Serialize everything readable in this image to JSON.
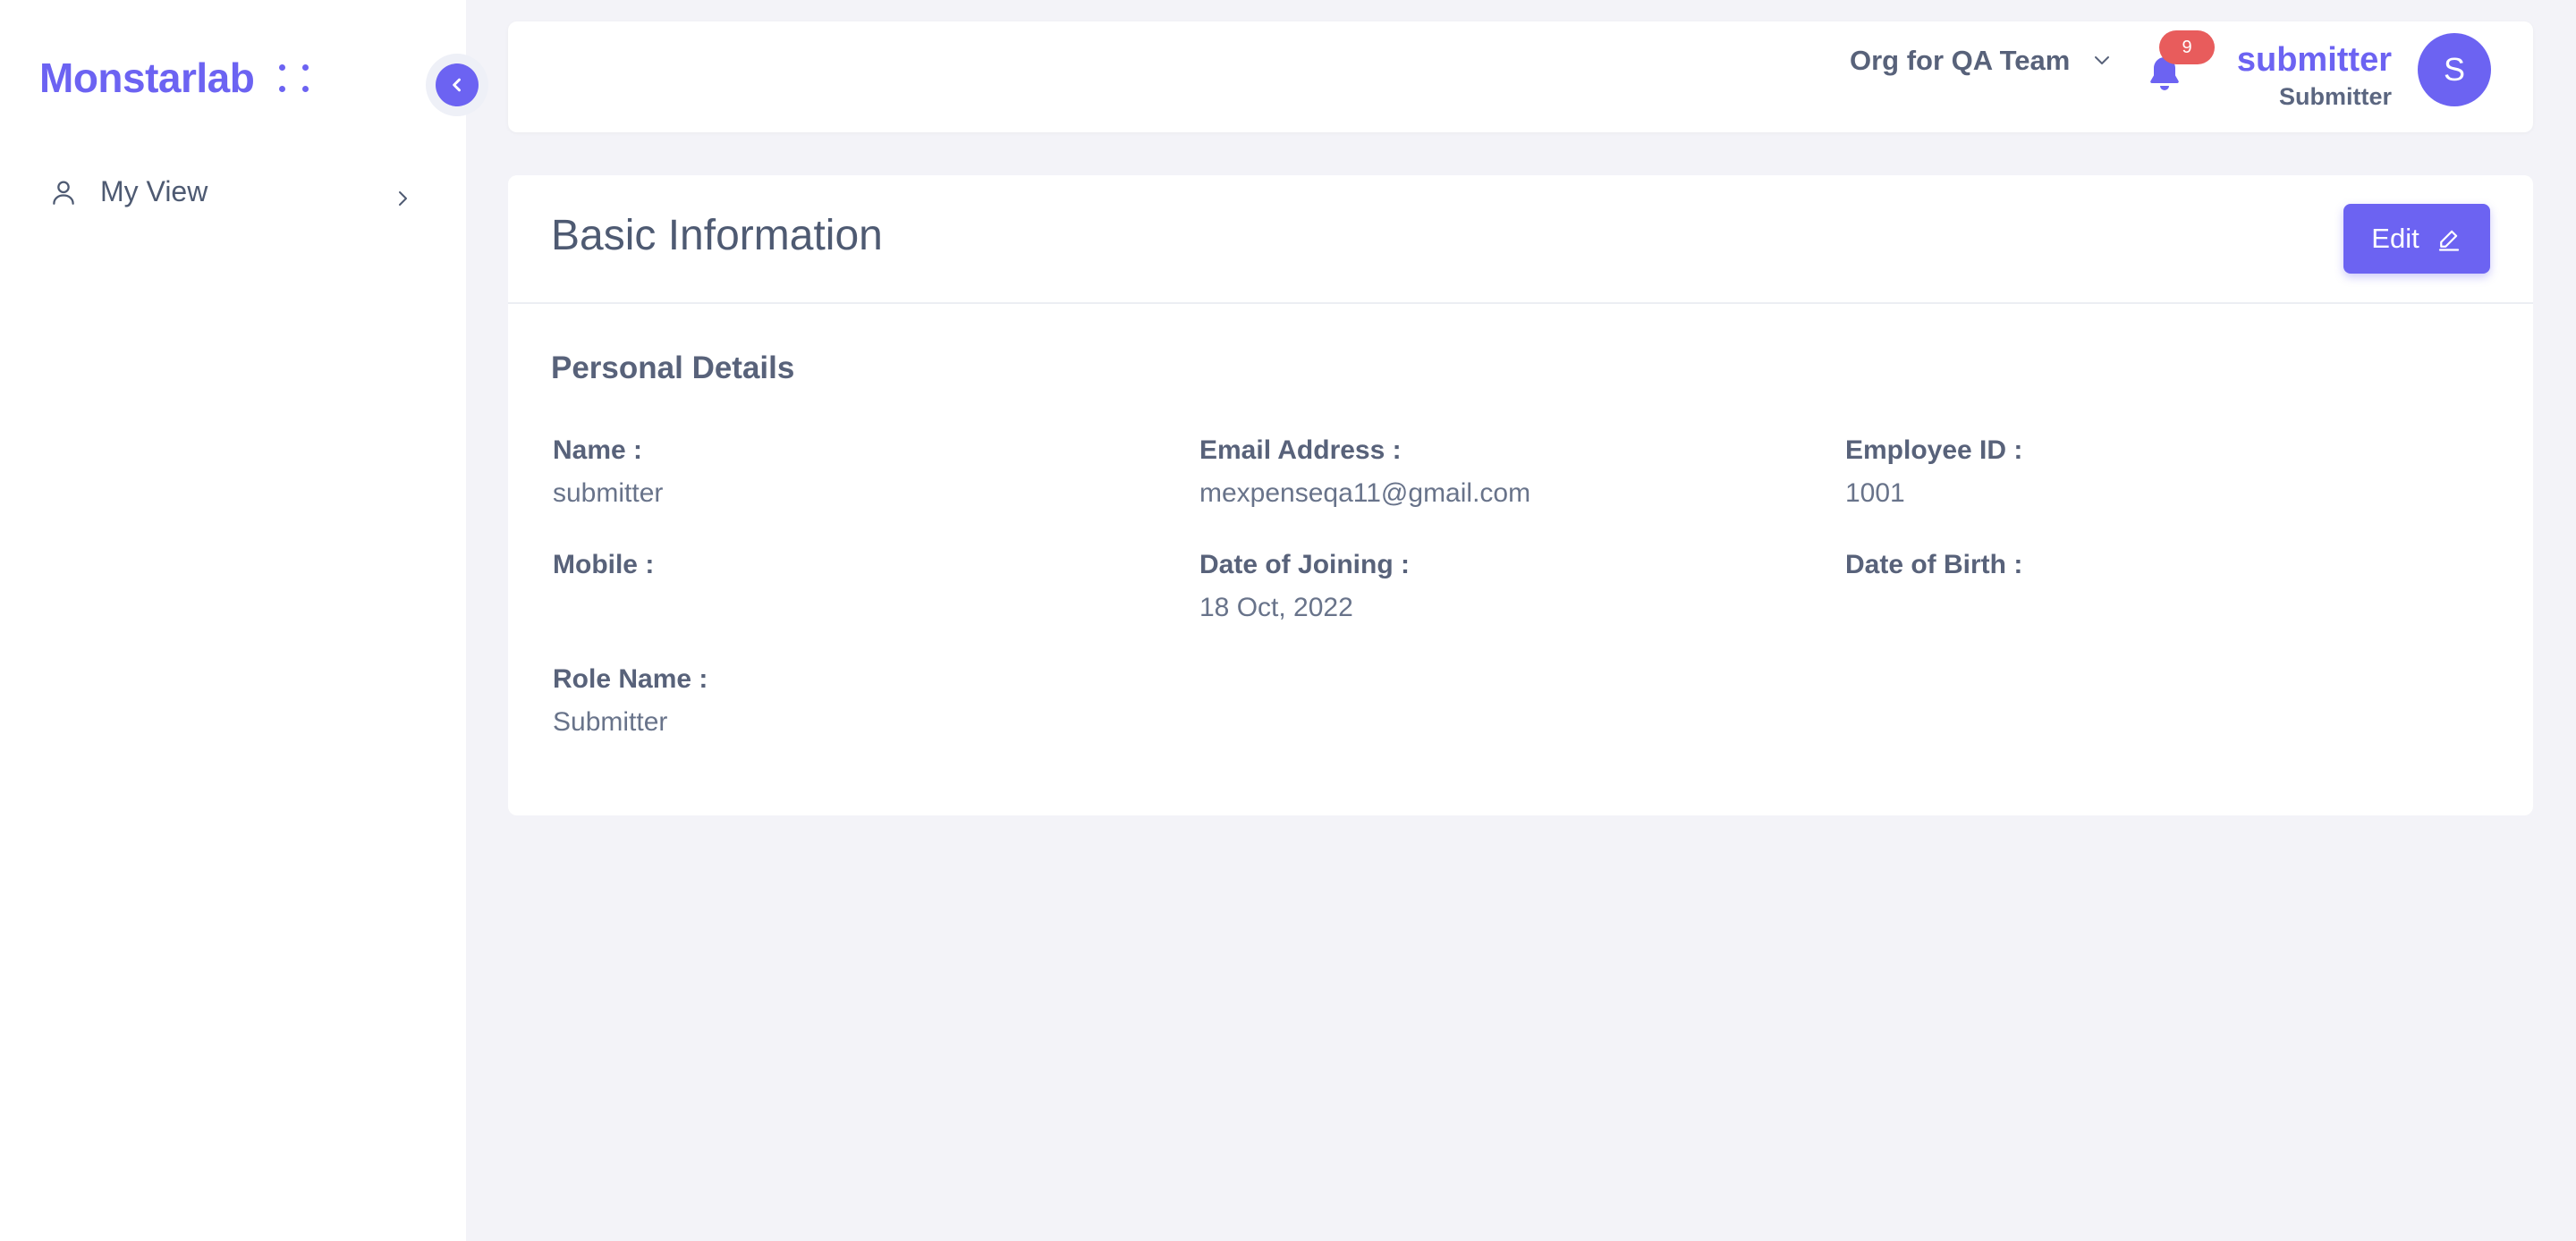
{
  "brand": {
    "name": "Monstarlab"
  },
  "sidebar": {
    "items": [
      {
        "label": "My View"
      }
    ]
  },
  "header": {
    "org": "Org for QA Team",
    "notifications": "9",
    "user": {
      "name": "submitter",
      "role": "Submitter",
      "initial": "S"
    }
  },
  "card": {
    "title": "Basic Information",
    "edit_label": "Edit",
    "section": "Personal Details",
    "fields": [
      {
        "label": "Name :",
        "value": "submitter"
      },
      {
        "label": "Email Address :",
        "value": "mexpenseqa11@gmail.com"
      },
      {
        "label": "Employee ID :",
        "value": "1001"
      },
      {
        "label": "Mobile :",
        "value": ""
      },
      {
        "label": "Date of Joining :",
        "value": "18 Oct, 2022"
      },
      {
        "label": "Date of Birth :",
        "value": ""
      },
      {
        "label": "Role Name :",
        "value": "Submitter"
      }
    ]
  },
  "colors": {
    "accent": "#6c63f2",
    "badge": "#e85c5c",
    "background": "#f3f3f8"
  },
  "icons": [
    "user-icon",
    "chevron-right-icon",
    "chevron-left-icon",
    "chevron-down-icon",
    "bell-icon",
    "pencil-icon"
  ]
}
